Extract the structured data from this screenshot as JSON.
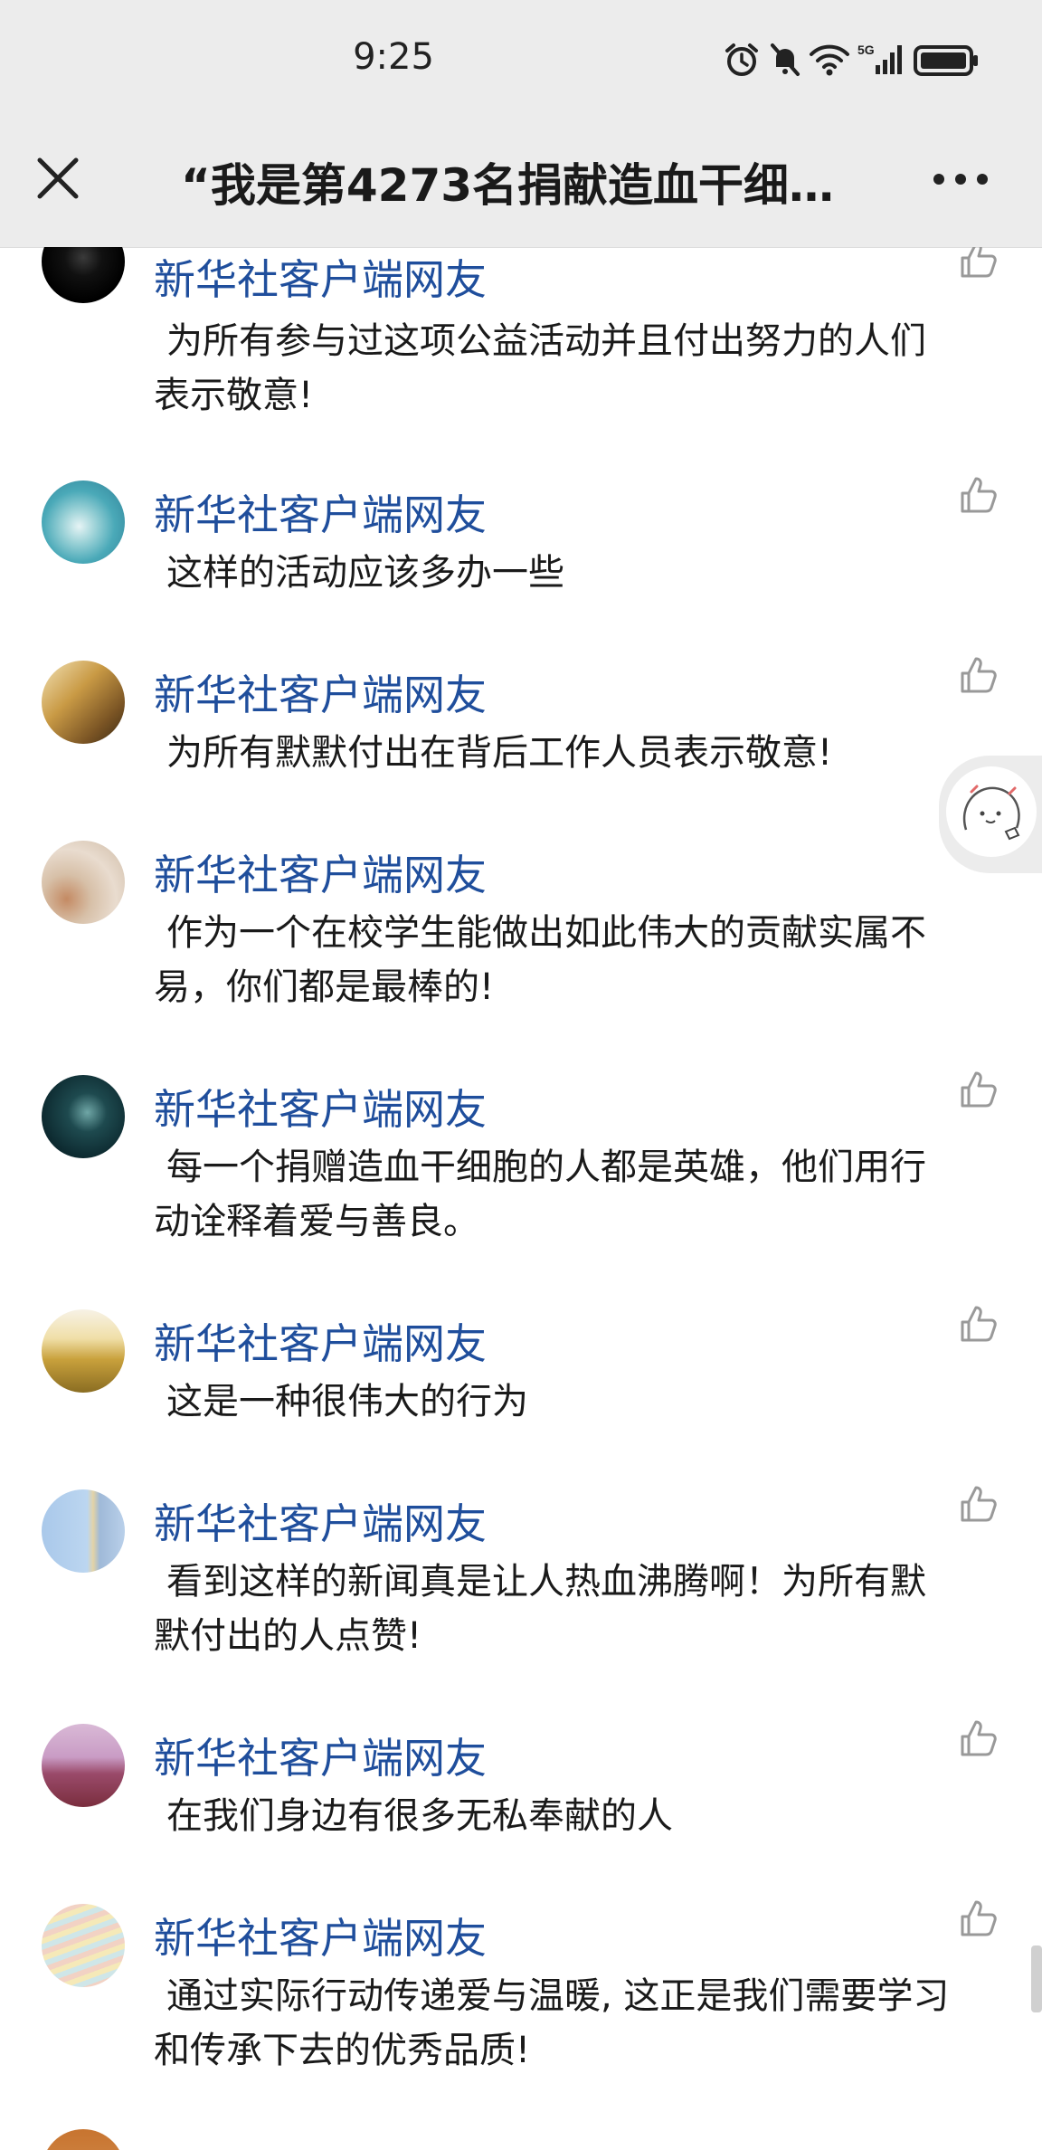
{
  "status_bar": {
    "time": "9:25",
    "network": "5G"
  },
  "nav": {
    "title": "“我是第4273名捐献造血干细…"
  },
  "comments": [
    {
      "user": "新华社客户端网友",
      "text": "为所有参与过这项公益活动并且付出努力的人们表示敬意!"
    },
    {
      "user": "新华社客户端网友",
      "text": "这样的活动应该多办一些"
    },
    {
      "user": "新华社客户端网友",
      "text": "为所有默默付出在背后工作人员表示敬意!"
    },
    {
      "user": "新华社客户端网友",
      "text": "作为一个在校学生能做出如此伟大的贡献实属不易，你们都是最棒的!"
    },
    {
      "user": "新华社客户端网友",
      "text": "每一个捐赠造血干细胞的人都是英雄，他们用行动诠释着爱与善良。"
    },
    {
      "user": "新华社客户端网友",
      "text": "这是一种很伟大的行为"
    },
    {
      "user": "新华社客户端网友",
      "text": "看到这样的新闻真是让人热血沸腾啊！为所有默默付出的人点赞!"
    },
    {
      "user": "新华社客户端网友",
      "text": "在我们身边有很多无私奉献的人"
    },
    {
      "user": "新华社客户端网友",
      "text": "通过实际行动传递爱与温暖, 这正是我们需要学习和传承下去的优秀品质!"
    }
  ],
  "icons": {
    "close": "close-icon",
    "more": "more-dots-icon",
    "like": "thumbs-up-icon",
    "status": [
      "alarm-icon",
      "mute-icon",
      "wifi-icon",
      "signal-5g-icon",
      "battery-icon"
    ]
  },
  "colors": {
    "username": "#1f4e9c",
    "bar_bg": "#ececec"
  }
}
